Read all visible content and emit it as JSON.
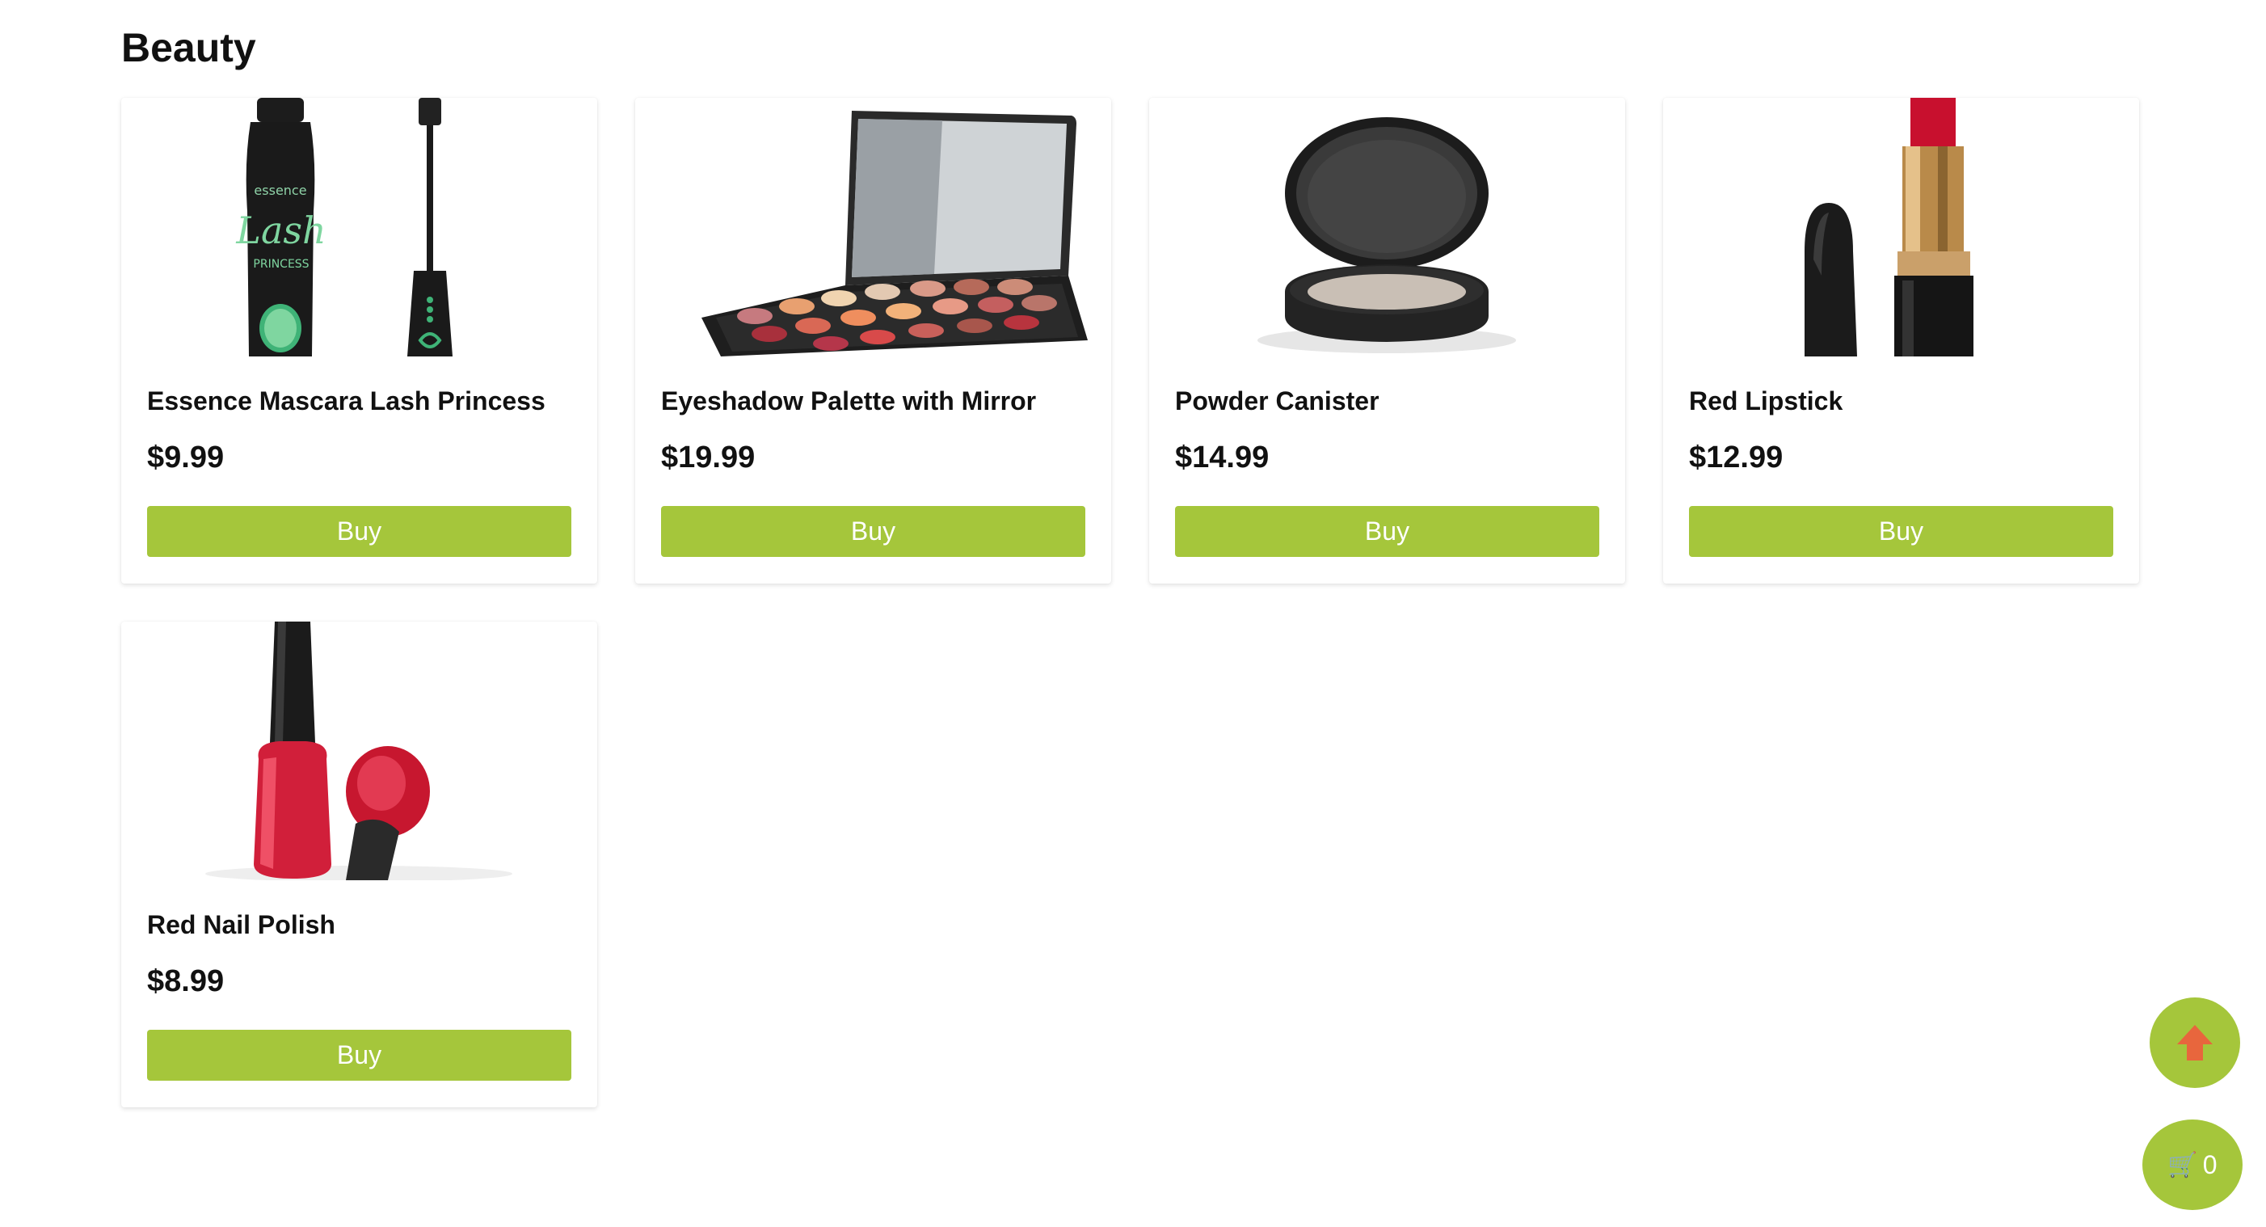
{
  "section": {
    "title": "Beauty"
  },
  "products": [
    {
      "name": "Essence Mascara Lash Princess",
      "price": "$9.99",
      "button": "Buy",
      "image_icon": "mascara-icon",
      "brand_text": "essence",
      "script_text": "Lash",
      "sub_text": "PRINCESS"
    },
    {
      "name": "Eyeshadow Palette with Mirror",
      "price": "$19.99",
      "button": "Buy",
      "image_icon": "eyeshadow-palette-icon"
    },
    {
      "name": "Powder Canister",
      "price": "$14.99",
      "button": "Buy",
      "image_icon": "powder-compact-icon"
    },
    {
      "name": "Red Lipstick",
      "price": "$12.99",
      "button": "Buy",
      "image_icon": "lipstick-icon"
    },
    {
      "name": "Red Nail Polish",
      "price": "$8.99",
      "button": "Buy",
      "image_icon": "nail-polish-icon"
    }
  ],
  "floating": {
    "scroll_top_icon": "arrow-up-icon",
    "cart_icon": "cart-icon",
    "cart_count": "0"
  },
  "colors": {
    "accent": "#a5c63b",
    "arrow": "#e8663d"
  }
}
